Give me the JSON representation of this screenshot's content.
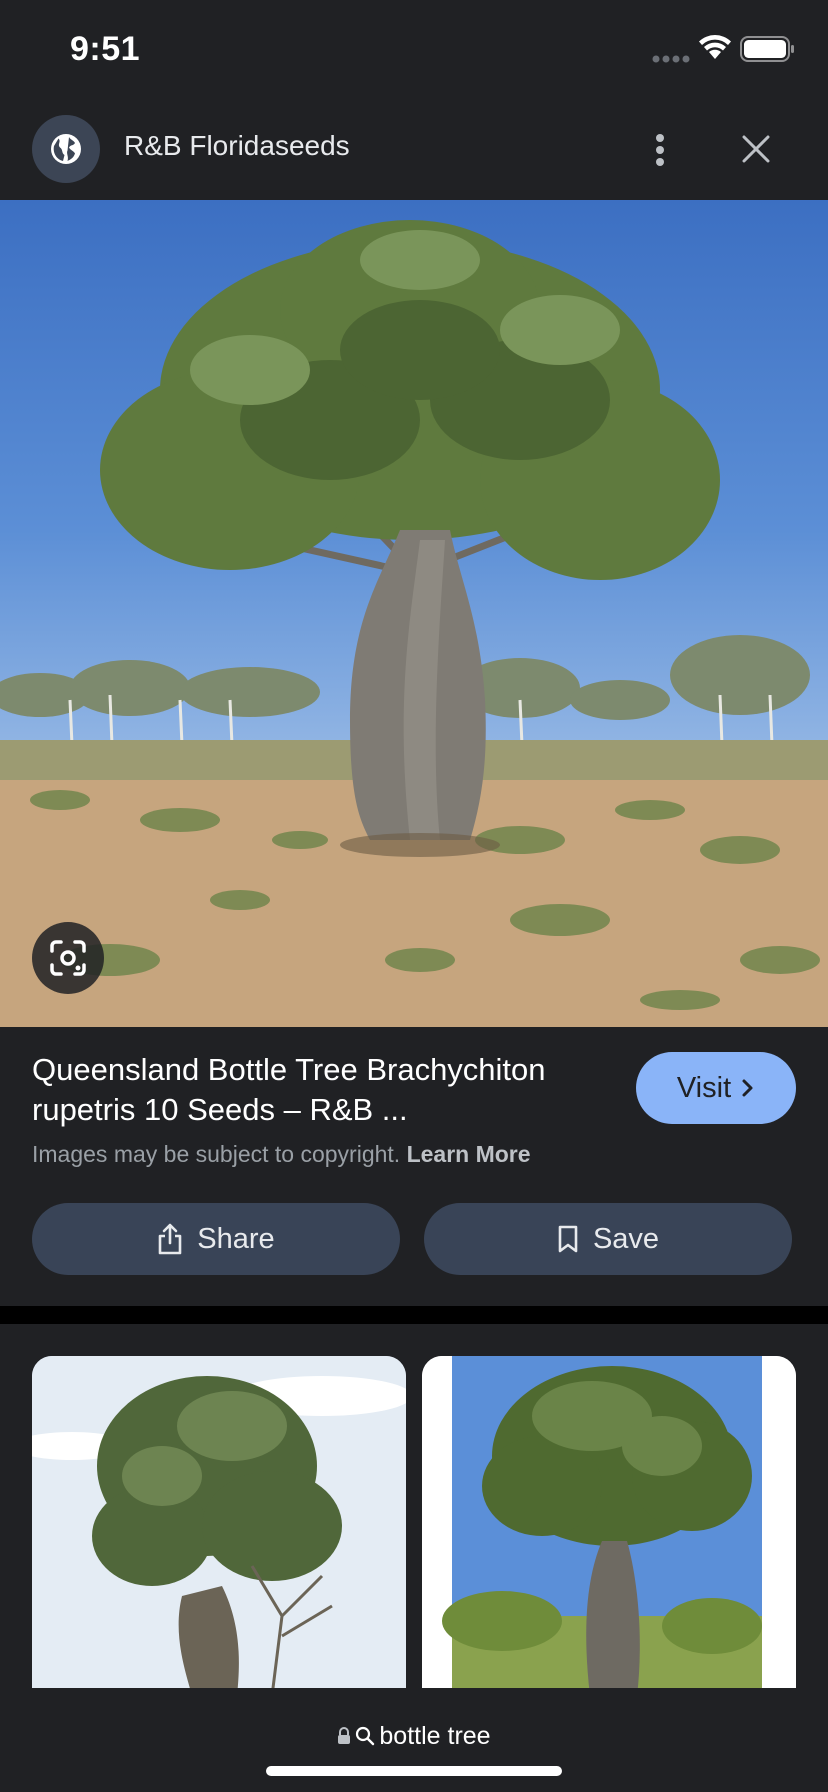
{
  "status_bar": {
    "time": "9:51",
    "signal_icon": "cellular-signal-icon",
    "wifi_icon": "wifi-icon",
    "battery_icon": "battery-icon"
  },
  "header": {
    "favicon_icon": "globe-icon",
    "site_name": "R&B Floridaseeds",
    "more_icon": "more-vertical-icon",
    "close_icon": "close-icon"
  },
  "main_image": {
    "subject": "Queensland bottle tree",
    "lens_icon": "google-lens-icon"
  },
  "result": {
    "title": "Queensland Bottle Tree Brachychiton rupetris 10 Seeds – R&B ...",
    "visit_label": "Visit",
    "visit_icon": "chevron-right-icon",
    "copyright_text": "Images may be subject to copyright.",
    "learn_more_label": "Learn More"
  },
  "actions": {
    "share_label": "Share",
    "share_icon": "share-icon",
    "save_label": "Save",
    "save_icon": "bookmark-icon"
  },
  "related": [
    {
      "subject": "bottle tree against sky"
    },
    {
      "subject": "bottle tree in bushland"
    }
  ],
  "url_bar": {
    "lock_icon": "lock-icon",
    "search_icon": "search-icon",
    "query": "bottle tree"
  },
  "colors": {
    "background": "#202124",
    "accent": "#8ab4f8",
    "button_bg": "#394457"
  }
}
